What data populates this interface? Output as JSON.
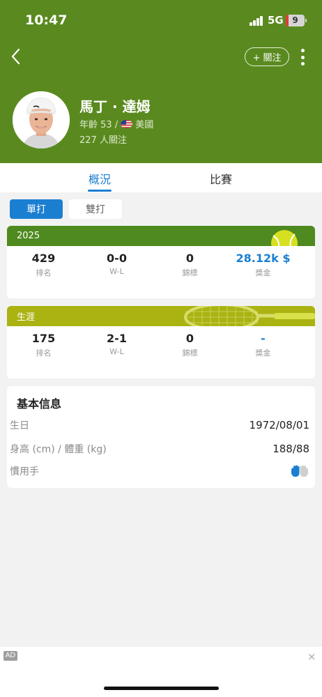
{
  "status_bar": {
    "time": "10:47",
    "network": "5G",
    "battery": "9"
  },
  "nav": {
    "follow_label": "+ 關注"
  },
  "player": {
    "name": "馬丁 · 達姆",
    "age_label": "年齡 53 /",
    "country": "美國",
    "followers": "227 人關注"
  },
  "tabs": [
    {
      "label": "概況",
      "active": true
    },
    {
      "label": "比賽",
      "active": false
    }
  ],
  "segments": {
    "singles": "單打",
    "doubles": "雙打"
  },
  "season_card": {
    "title": "2025",
    "stats": [
      {
        "value": "429",
        "label": "排名"
      },
      {
        "value": "0-0",
        "label": "W-L"
      },
      {
        "value": "0",
        "label": "錦標"
      },
      {
        "value": "28.12k $",
        "label": "獎金"
      }
    ]
  },
  "career_card": {
    "title": "生涯",
    "stats": [
      {
        "value": "175",
        "label": "排名"
      },
      {
        "value": "2-1",
        "label": "W-L"
      },
      {
        "value": "0",
        "label": "錦標"
      },
      {
        "value": "-",
        "label": "獎金"
      }
    ]
  },
  "basic_info": {
    "title": "基本信息",
    "birthday_label": "生日",
    "birthday": "1972/08/01",
    "height_weight_label": "身高 (cm) / 體重 (kg)",
    "height_weight": "188/88",
    "handedness_label": "慣用手",
    "handedness_icon": "right-hand-icon"
  },
  "ad": {
    "tag": "AD",
    "close": "×"
  },
  "colors": {
    "header_green": "#5a8a1f",
    "accent_blue": "#1b7fd1",
    "season_green": "#4e8a1f",
    "career_olive": "#aab312"
  }
}
